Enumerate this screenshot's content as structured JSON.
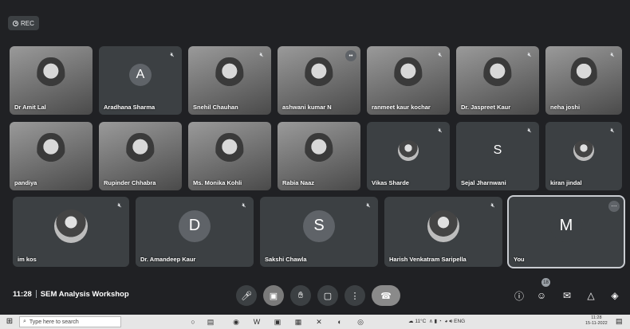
{
  "recording_label": "REC",
  "tiles_row1": [
    {
      "name": "Dr Amit Lal",
      "type": "video"
    },
    {
      "name": "Aradhana Sharma",
      "type": "avatar",
      "initial": "A"
    },
    {
      "name": "Snehil Chauhan",
      "type": "video"
    },
    {
      "name": "ashwani kumar N",
      "type": "video"
    },
    {
      "name": "ranmeet kaur kochar",
      "type": "video"
    },
    {
      "name": "Dr. Jaspreet Kaur",
      "type": "video"
    },
    {
      "name": "neha joshi",
      "type": "video"
    }
  ],
  "tiles_row2": [
    {
      "name": "pandiya",
      "type": "video"
    },
    {
      "name": "Rupinder Chhabra",
      "type": "video"
    },
    {
      "name": "Ms. Monika Kohli",
      "type": "video"
    },
    {
      "name": "Rabia Naaz",
      "type": "video"
    },
    {
      "name": "Vikas Sharde",
      "type": "photo"
    },
    {
      "name": "Sejal Jharnwani",
      "type": "avatar",
      "initial": "S"
    },
    {
      "name": "kiran jindal",
      "type": "photo"
    }
  ],
  "tiles_row3": [
    {
      "name": "im kos",
      "type": "photo"
    },
    {
      "name": "Dr. Amandeep Kaur",
      "type": "avatar",
      "initial": "D"
    },
    {
      "name": "Sakshi Chawla",
      "type": "avatar",
      "initial": "S"
    },
    {
      "name": "Harish Venkatram Saripella",
      "type": "photo"
    },
    {
      "name": "You",
      "type": "avatar",
      "initial": "M",
      "active": true
    }
  ],
  "meeting": {
    "time": "11:28",
    "title": "SEM Analysis Workshop"
  },
  "participants_count": "18",
  "taskbar": {
    "search_placeholder": "Type here to search",
    "weather": "11°C",
    "lang": "ENG",
    "clock_time": "11:28",
    "clock_date": "15-11-2022"
  },
  "colors": {
    "meet_bg": "#202124",
    "tile_bg": "#3c4043",
    "avatar_bg": "#5f6368"
  }
}
